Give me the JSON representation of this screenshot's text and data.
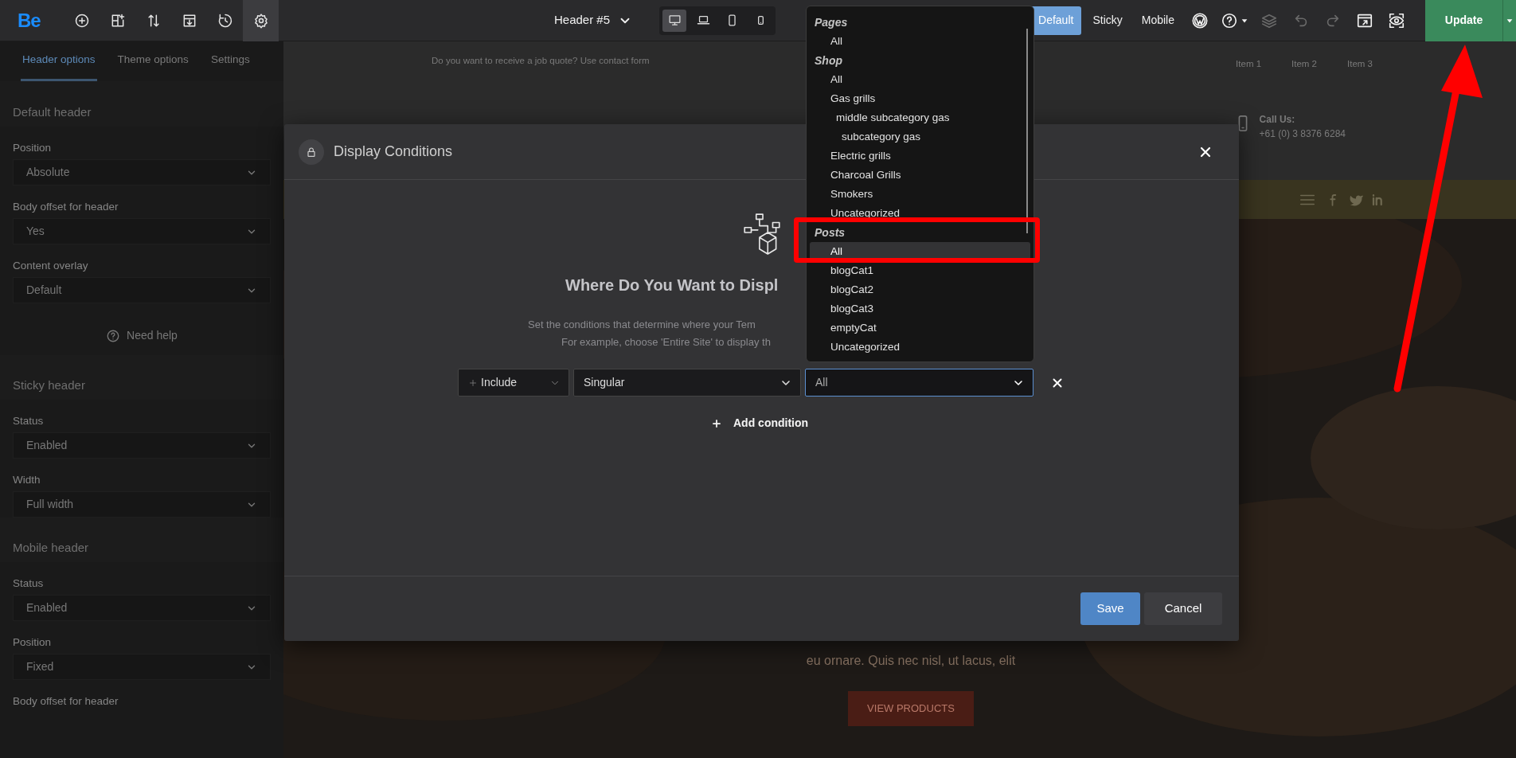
{
  "topbar": {
    "logo": "Be",
    "tools": [
      {
        "kind": "add",
        "selected": false
      },
      {
        "kind": "layout",
        "selected": false
      },
      {
        "kind": "sort",
        "selected": false
      },
      {
        "kind": "import",
        "selected": false
      },
      {
        "kind": "history",
        "selected": false
      },
      {
        "kind": "settings",
        "selected": true
      }
    ],
    "header_picker": "Header #5",
    "devices": [
      {
        "kind": "desktop",
        "selected": true
      },
      {
        "kind": "laptop",
        "selected": false
      },
      {
        "kind": "tablet",
        "selected": false
      },
      {
        "kind": "mobile",
        "selected": false
      }
    ],
    "modes": [
      {
        "label": "Default",
        "selected": true
      },
      {
        "label": "Sticky",
        "selected": false
      },
      {
        "label": "Mobile",
        "selected": false
      }
    ],
    "actions": [
      {
        "kind": "wordpress",
        "disabled": false
      },
      {
        "kind": "help",
        "disabled": false
      },
      {
        "kind": "layers",
        "disabled": true
      },
      {
        "kind": "undo",
        "disabled": true
      },
      {
        "kind": "redo",
        "disabled": true
      },
      {
        "kind": "window",
        "disabled": false
      },
      {
        "kind": "preview",
        "disabled": false
      }
    ],
    "update_button": "Update"
  },
  "sidebar": {
    "tabs": [
      {
        "label": "Header options",
        "selected": true
      },
      {
        "label": "Theme options",
        "selected": false
      },
      {
        "label": "Settings",
        "selected": false
      }
    ],
    "sections": [
      {
        "title": "Default header",
        "fields": [
          {
            "label": "Position",
            "value": "Absolute"
          },
          {
            "label": "Body offset for header",
            "value": "Yes"
          },
          {
            "label": "Content overlay",
            "value": "Default"
          }
        ],
        "help": "Need help"
      },
      {
        "title": "Sticky header",
        "fields": [
          {
            "label": "Status",
            "value": "Enabled"
          },
          {
            "label": "Width",
            "value": "Full width"
          }
        ]
      },
      {
        "title": "Mobile header",
        "fields": [
          {
            "label": "Status",
            "value": "Enabled"
          },
          {
            "label": "Position",
            "value": "Fixed"
          },
          {
            "label": "Body offset for header"
          }
        ]
      }
    ]
  },
  "preview": {
    "top_text": "Do you want to receive a job quote? Use contact form",
    "menu": [
      "Item 1",
      "Item 2",
      "Item 3"
    ],
    "contact_label": "Call Us:",
    "contact_phone": "+61 (0) 3 8376 6284",
    "hero_text": "eu ornare. Quis nec nisl, ut lacus, elit",
    "hero_button": "VIEW PRODUCTS"
  },
  "modal": {
    "title": "Display Conditions",
    "heading": "Where Do You Want to Displ",
    "description": [
      "Set the conditions that determine where your Tem",
      "For example, choose 'Entire Site' to display th"
    ],
    "conditions": [
      {
        "type": "Include",
        "scope": "Singular",
        "target": "All"
      }
    ],
    "add_button": "Add condition",
    "save_button": "Save",
    "cancel_button": "Cancel"
  },
  "dropdown": {
    "groups": [
      {
        "label": "Pages",
        "items": [
          {
            "label": "All",
            "selected": false
          }
        ]
      },
      {
        "label": "Shop",
        "items": [
          {
            "label": "All",
            "selected": false
          },
          {
            "label": "Gas grills",
            "selected": false,
            "children": [
              {
                "label": "middle subcategory gas",
                "selected": false,
                "children": [
                  {
                    "label": "subcategory gas",
                    "selected": false
                  }
                ]
              }
            ]
          },
          {
            "label": "Electric grills",
            "selected": false
          },
          {
            "label": "Charcoal Grills",
            "selected": false
          },
          {
            "label": "Smokers",
            "selected": false
          },
          {
            "label": "Uncategorized",
            "selected": false
          }
        ]
      },
      {
        "label": "Posts",
        "items": [
          {
            "label": "All",
            "selected": true
          },
          {
            "label": "blogCat1",
            "selected": false
          },
          {
            "label": "blogCat2",
            "selected": false
          },
          {
            "label": "blogCat3",
            "selected": false
          },
          {
            "label": "emptyCat",
            "selected": false
          },
          {
            "label": "Uncategorized",
            "selected": false
          }
        ]
      }
    ]
  }
}
